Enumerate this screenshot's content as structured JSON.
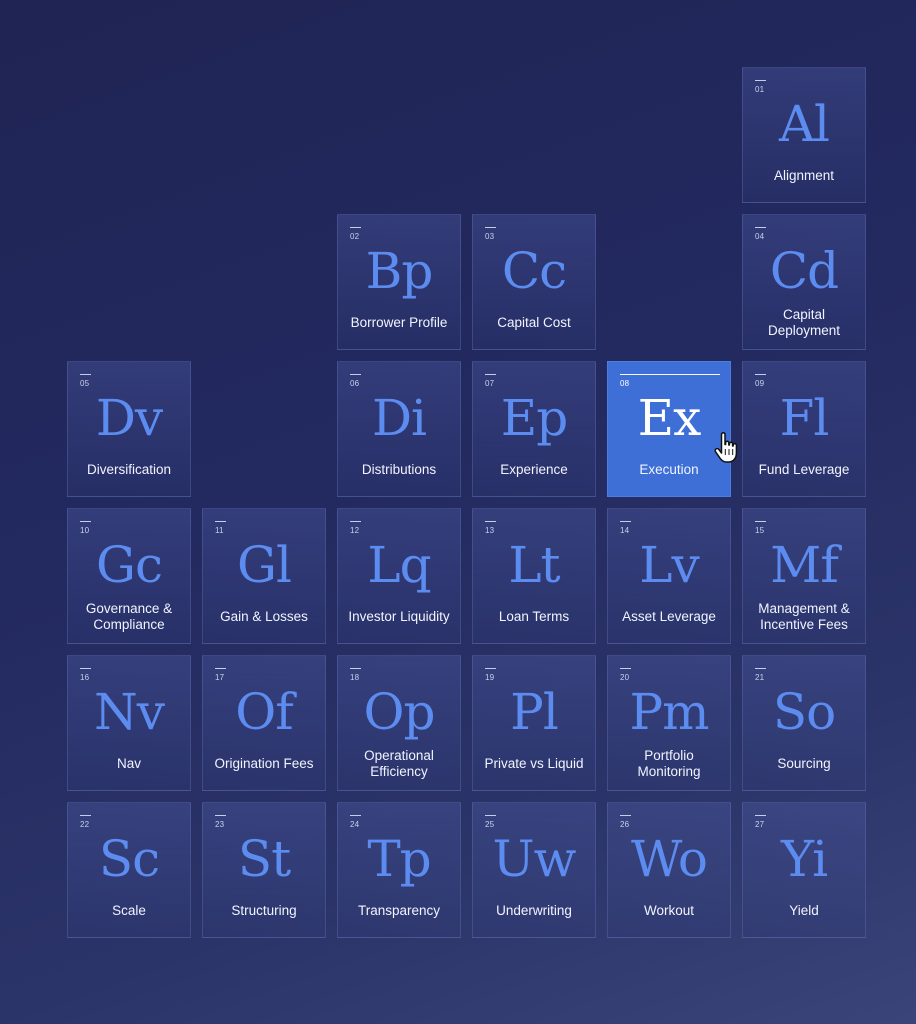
{
  "elements": [
    {
      "num": "01",
      "symbol": "Al",
      "name": "Alignment"
    },
    {
      "num": "02",
      "symbol": "Bp",
      "name": "Borrower Profile"
    },
    {
      "num": "03",
      "symbol": "Cc",
      "name": "Capital Cost"
    },
    {
      "num": "04",
      "symbol": "Cd",
      "name": "Capital Deployment"
    },
    {
      "num": "05",
      "symbol": "Dv",
      "name": "Diversification"
    },
    {
      "num": "06",
      "symbol": "Di",
      "name": "Distributions"
    },
    {
      "num": "07",
      "symbol": "Ep",
      "name": "Experience"
    },
    {
      "num": "08",
      "symbol": "Ex",
      "name": "Execution"
    },
    {
      "num": "09",
      "symbol": "Fl",
      "name": "Fund Leverage"
    },
    {
      "num": "10",
      "symbol": "Gc",
      "name": "Governance & Compliance"
    },
    {
      "num": "11",
      "symbol": "Gl",
      "name": "Gain & Losses"
    },
    {
      "num": "12",
      "symbol": "Lq",
      "name": "Investor Liquidity"
    },
    {
      "num": "13",
      "symbol": "Lt",
      "name": "Loan Terms"
    },
    {
      "num": "14",
      "symbol": "Lv",
      "name": "Asset Leverage"
    },
    {
      "num": "15",
      "symbol": "Mf",
      "name": "Management & Incentive Fees"
    },
    {
      "num": "16",
      "symbol": "Nv",
      "name": "Nav"
    },
    {
      "num": "17",
      "symbol": "Of",
      "name": "Origination Fees"
    },
    {
      "num": "18",
      "symbol": "Op",
      "name": "Operational Efficiency"
    },
    {
      "num": "19",
      "symbol": "Pl",
      "name": "Private vs Liquid"
    },
    {
      "num": "20",
      "symbol": "Pm",
      "name": "Portfolio Monitoring"
    },
    {
      "num": "21",
      "symbol": "So",
      "name": "Sourcing"
    },
    {
      "num": "22",
      "symbol": "Sc",
      "name": "Scale"
    },
    {
      "num": "23",
      "symbol": "St",
      "name": "Structuring"
    },
    {
      "num": "24",
      "symbol": "Tp",
      "name": "Transparency"
    },
    {
      "num": "25",
      "symbol": "Uw",
      "name": "Underwriting"
    },
    {
      "num": "26",
      "symbol": "Wo",
      "name": "Workout"
    },
    {
      "num": "27",
      "symbol": "Yi",
      "name": "Yield"
    }
  ],
  "active_element": "Ex",
  "cursor_icon": "hand-pointer-icon",
  "colors": {
    "symbol": "#5c8cf0",
    "active_tile": "#3d6fd6",
    "background": "#232a60"
  }
}
